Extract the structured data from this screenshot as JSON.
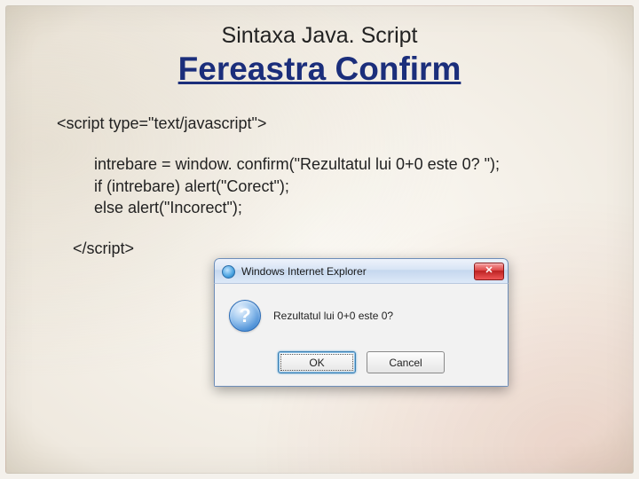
{
  "slide": {
    "subtitle": "Sintaxa Java. Script",
    "title": "Fereastra Confirm",
    "code": {
      "open": "<script type=\"text/javascript\">",
      "line1": "intrebare = window. confirm(\"Rezultatul lui 0+0 este 0? \");",
      "line2": "if (intrebare) alert(\"Corect\");",
      "line3": "else alert(\"Incorect\");",
      "close": "</script>"
    }
  },
  "dialog": {
    "title": "Windows Internet Explorer",
    "close_glyph": "✕",
    "question_glyph": "?",
    "message": "Rezultatul lui 0+0 este 0?",
    "ok_label": "OK",
    "cancel_label": "Cancel"
  }
}
